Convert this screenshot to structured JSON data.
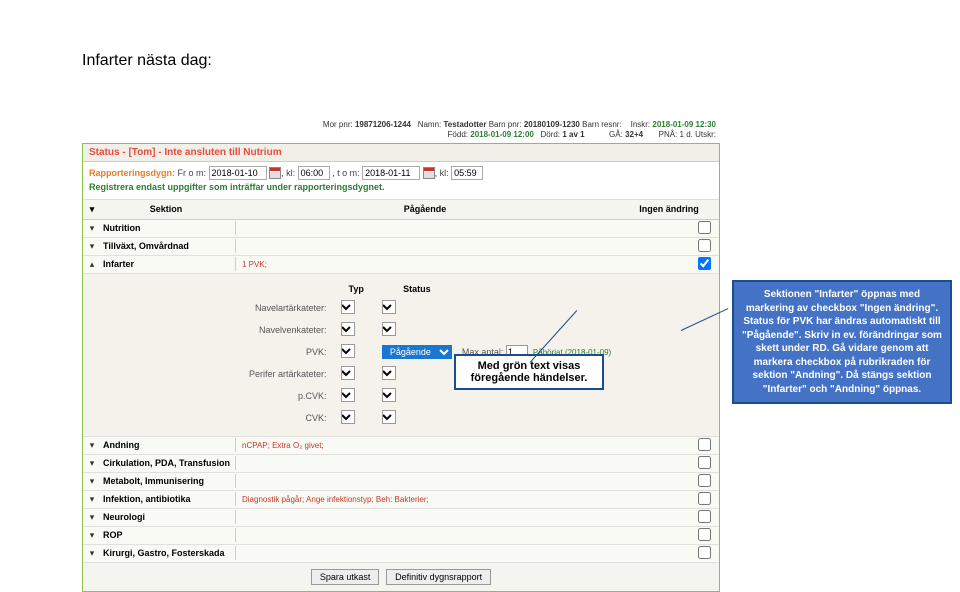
{
  "page_title": "Infarter nästa dag:",
  "header": {
    "mor_pnr_label": "Mor pnr:",
    "mor_pnr": "19871206-1244",
    "namn_label": "Namn:",
    "namn": "Testadotter",
    "barn_pnr_label": "Barn pnr:",
    "barn_pnr": "20180109-1230",
    "barn_resnr_label": "Barn resnr:",
    "inskr_label": "Inskr:",
    "inskr": "2018-01-09 12:30",
    "fodd_label": "Född:",
    "fodd": "2018-01-09 12:00",
    "dord_label": "Dörd:",
    "dord": "1 av 1",
    "ga_label": "GÅ:",
    "ga": "32+4",
    "pna_label": "PNÅ: 1 d. Utskr:"
  },
  "status_bar": "Status - [Tom] - Inte ansluten till Nutrium",
  "report": {
    "label": "Rapporteringsdygn:",
    "from_label": "Fr o m:",
    "from_date": "2018-01-10",
    "from_time": "06:00",
    "to_label": ", t o m:",
    "to_date": "2018-01-11",
    "to_time": "05:59",
    "note": "Registrera endast uppgifter som inträffar under rapporteringsdygnet."
  },
  "columns": {
    "section": "Sektion",
    "ongoing": "Pågående",
    "nochange": "Ingen ändring"
  },
  "sections": [
    {
      "label": "Nutrition",
      "content": "",
      "expanded": false,
      "checked": false
    },
    {
      "label": "Tillväxt, Omvårdnad",
      "content": "",
      "expanded": false,
      "checked": false
    },
    {
      "label": "Infarter",
      "content": "1 PVK;",
      "expanded": true,
      "checked": true
    },
    {
      "label": "Andning",
      "content": "nCPAP; Extra O₂ givet;",
      "expanded": false,
      "checked": false
    },
    {
      "label": "Cirkulation, PDA, Transfusion",
      "content": "",
      "expanded": false,
      "checked": false
    },
    {
      "label": "Metabolt, Immunisering",
      "content": "",
      "expanded": false,
      "checked": false
    },
    {
      "label": "Infektion, antibiotika",
      "content": "Diagnostik pågår; Ange infektionstyp; Beh: Bakterier;",
      "expanded": false,
      "checked": false
    },
    {
      "label": "Neurologi",
      "content": "",
      "expanded": false,
      "checked": false
    },
    {
      "label": "ROP",
      "content": "",
      "expanded": false,
      "checked": false
    },
    {
      "label": "Kirurgi, Gastro, Fosterskada",
      "content": "",
      "expanded": false,
      "checked": false
    }
  ],
  "infarter": {
    "col_typ": "Typ",
    "col_status": "Status",
    "rows": [
      {
        "name": "Navelartärkateter:"
      },
      {
        "name": "Navelvenkateter:"
      },
      {
        "name": "PVK:",
        "status": "Pågående",
        "max_label": "Max antal:",
        "max": "1",
        "started": "Påbörjat (2018-01-09)"
      },
      {
        "name": "Perifer artärkateter:"
      },
      {
        "name": "p.CVK:"
      },
      {
        "name": "CVK:"
      }
    ]
  },
  "buttons": {
    "save": "Spara utkast",
    "final": "Definitiv dygnsrapport"
  },
  "callouts": {
    "green": "Med grön text visas föregående händelser.",
    "blue": "Sektionen \"Infarter\" öppnas med markering av checkbox \"Ingen ändring\". Status för PVK har ändras automatiskt till \"Pågående\". Skriv in ev. förändringar som skett under RD. Gå vidare genom att markera checkbox på rubrikraden för sektion \"Andning\". Då stängs sektion \"Infarter\" och \"Andning\" öppnas."
  }
}
